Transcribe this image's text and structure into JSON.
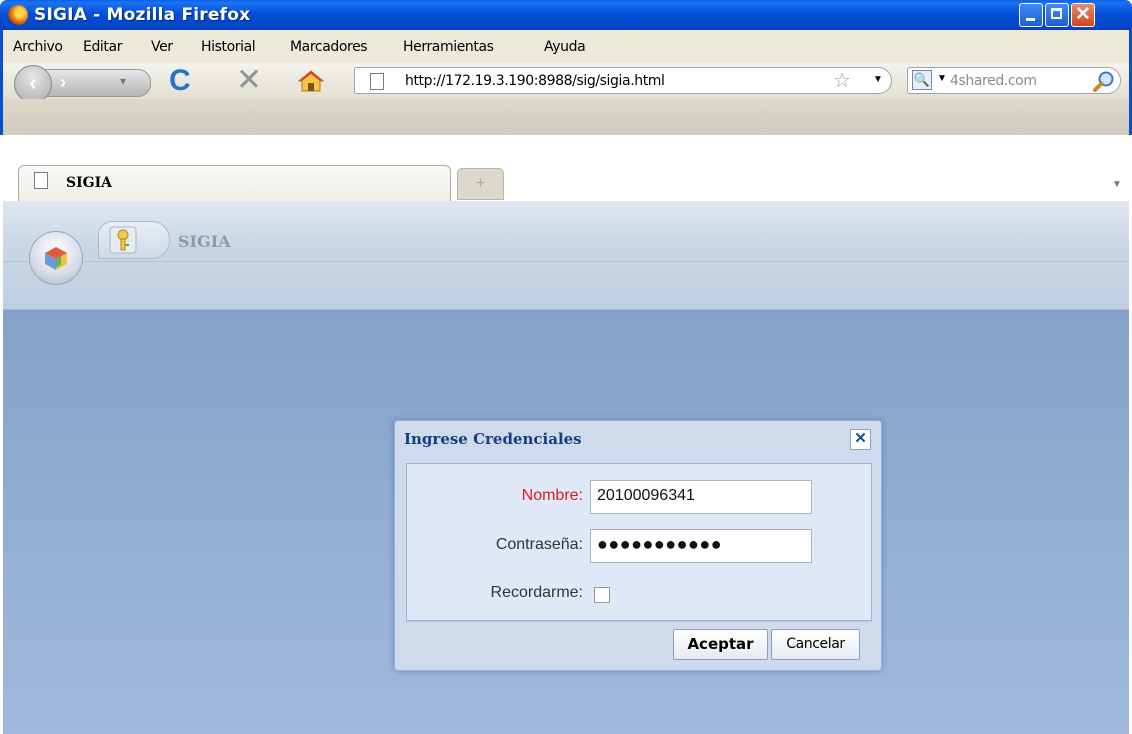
{
  "window": {
    "title": "SIGIA - Mozilla Firefox",
    "controls": {
      "minimize": "minimize",
      "maximize": "maximize",
      "close": "✕"
    }
  },
  "menubar": {
    "items": [
      "Archivo",
      "Editar",
      "Ver",
      "Historial",
      "Marcadores",
      "Herramientas",
      "Ayuda"
    ]
  },
  "navbar": {
    "url": "http://172.19.3.190:8988/sig/sigia.html",
    "search_placeholder": "4shared.com",
    "reload_glyph": "C",
    "stop_glyph": "✕"
  },
  "tabs": {
    "active_label": "SIGIA",
    "newtab_glyph": "+"
  },
  "app": {
    "tab_label": "SIGIA"
  },
  "dialog": {
    "title": "Ingrese Credenciales",
    "close_glyph": "✕",
    "fields": {
      "username_label": "Nombre:",
      "username_value": "20100096341",
      "password_label": "Contraseña:",
      "password_value": "●●●●●●●●●●●",
      "remember_label": "Recordarme:",
      "remember_checked": false
    },
    "buttons": {
      "accept": "Aceptar",
      "cancel": "Cancelar"
    }
  },
  "colors": {
    "titlebar": "#0550d8",
    "required_label": "#e01b1b",
    "dialog_title": "#153e7e"
  }
}
